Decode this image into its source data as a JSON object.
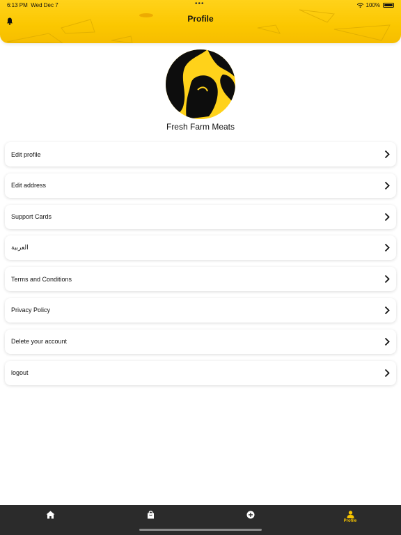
{
  "status_bar": {
    "time": "6:13 PM",
    "date": "Wed Dec 7",
    "battery": "100%"
  },
  "header": {
    "title": "Profile",
    "notification_icon": "bell-icon"
  },
  "profile": {
    "store_name": "Fresh Farm Meats"
  },
  "menu": [
    {
      "label": "Edit profile"
    },
    {
      "label": "Edit address"
    },
    {
      "label": "Support Cards"
    },
    {
      "label": "العربية"
    },
    {
      "label": "Terms and Conditions"
    },
    {
      "label": "Privacy Policy"
    },
    {
      "label": "Delete your account"
    },
    {
      "label": "logout"
    }
  ],
  "tabbar": {
    "tabs": [
      {
        "icon": "home-icon"
      },
      {
        "icon": "shopping-bag-icon"
      },
      {
        "icon": "add-circle-icon"
      },
      {
        "icon": "person-icon",
        "label": "Profile",
        "active": true
      }
    ]
  },
  "colors": {
    "accent": "#f7c400",
    "tabbar_bg": "#2b2b2b"
  }
}
